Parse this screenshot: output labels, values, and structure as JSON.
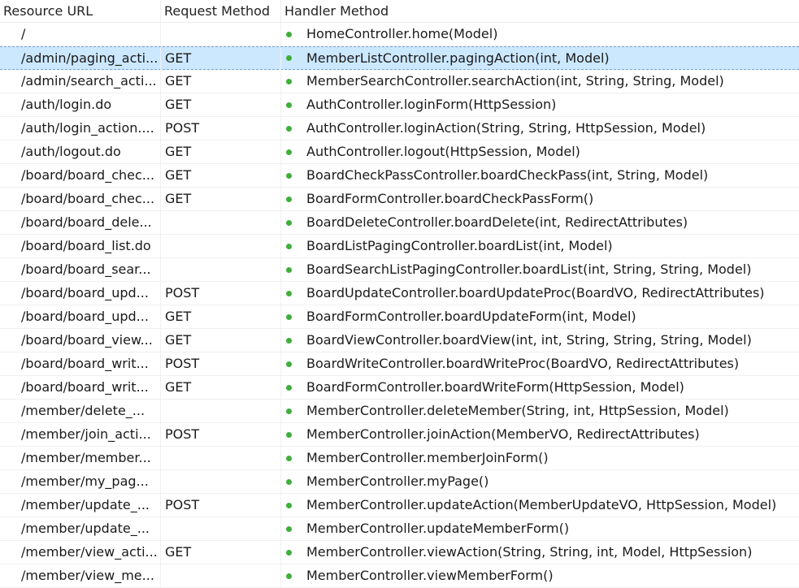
{
  "headers": {
    "resource": "Resource URL",
    "method": "Request Method",
    "handler": "Handler Method"
  },
  "selected_index": 1,
  "accent": {
    "selection": "#cce8ff",
    "dot": "#3fae3a"
  },
  "rows": [
    {
      "url": "/",
      "method": "",
      "handler": "HomeController.home(Model)"
    },
    {
      "url": "/admin/paging_acti...",
      "method": "GET",
      "handler": "MemberListController.pagingAction(int, Model)"
    },
    {
      "url": "/admin/search_acti...",
      "method": "GET",
      "handler": "MemberSearchController.searchAction(int, String, String, Model)"
    },
    {
      "url": "/auth/login.do",
      "method": "GET",
      "handler": "AuthController.loginForm(HttpSession)"
    },
    {
      "url": "/auth/login_action....",
      "method": "POST",
      "handler": "AuthController.loginAction(String, String, HttpSession, Model)"
    },
    {
      "url": "/auth/logout.do",
      "method": "GET",
      "handler": "AuthController.logout(HttpSession, Model)"
    },
    {
      "url": "/board/board_chec...",
      "method": "GET",
      "handler": "BoardCheckPassController.boardCheckPass(int, String, Model)"
    },
    {
      "url": "/board/board_chec...",
      "method": "GET",
      "handler": "BoardFormController.boardCheckPassForm()"
    },
    {
      "url": "/board/board_dele...",
      "method": "",
      "handler": "BoardDeleteController.boardDelete(int, RedirectAttributes)"
    },
    {
      "url": "/board/board_list.do",
      "method": "",
      "handler": "BoardListPagingController.boardList(int, Model)"
    },
    {
      "url": "/board/board_sear...",
      "method": "",
      "handler": "BoardSearchListPagingController.boardList(int, String, String, Model)"
    },
    {
      "url": "/board/board_upd...",
      "method": "POST",
      "handler": "BoardUpdateController.boardUpdateProc(BoardVO, RedirectAttributes)"
    },
    {
      "url": "/board/board_upd...",
      "method": "GET",
      "handler": "BoardFormController.boardUpdateForm(int, Model)"
    },
    {
      "url": "/board/board_view...",
      "method": "GET",
      "handler": "BoardViewController.boardView(int, int, String, String, String, Model)"
    },
    {
      "url": "/board/board_writ...",
      "method": "POST",
      "handler": "BoardWriteController.boardWriteProc(BoardVO, RedirectAttributes)"
    },
    {
      "url": "/board/board_writ...",
      "method": "GET",
      "handler": "BoardFormController.boardWriteForm(HttpSession, Model)"
    },
    {
      "url": "/member/delete_...",
      "method": "",
      "handler": "MemberController.deleteMember(String, int, HttpSession, Model)"
    },
    {
      "url": "/member/join_acti...",
      "method": "POST",
      "handler": "MemberController.joinAction(MemberVO, RedirectAttributes)"
    },
    {
      "url": "/member/member...",
      "method": "",
      "handler": "MemberController.memberJoinForm()"
    },
    {
      "url": "/member/my_pag...",
      "method": "",
      "handler": "MemberController.myPage()"
    },
    {
      "url": "/member/update_...",
      "method": "POST",
      "handler": "MemberController.updateAction(MemberUpdateVO, HttpSession, Model)"
    },
    {
      "url": "/member/update_...",
      "method": "",
      "handler": "MemberController.updateMemberForm()"
    },
    {
      "url": "/member/view_acti...",
      "method": "GET",
      "handler": "MemberController.viewAction(String, String, int, Model, HttpSession)"
    },
    {
      "url": "/member/view_me...",
      "method": "",
      "handler": "MemberController.viewMemberForm()"
    }
  ]
}
